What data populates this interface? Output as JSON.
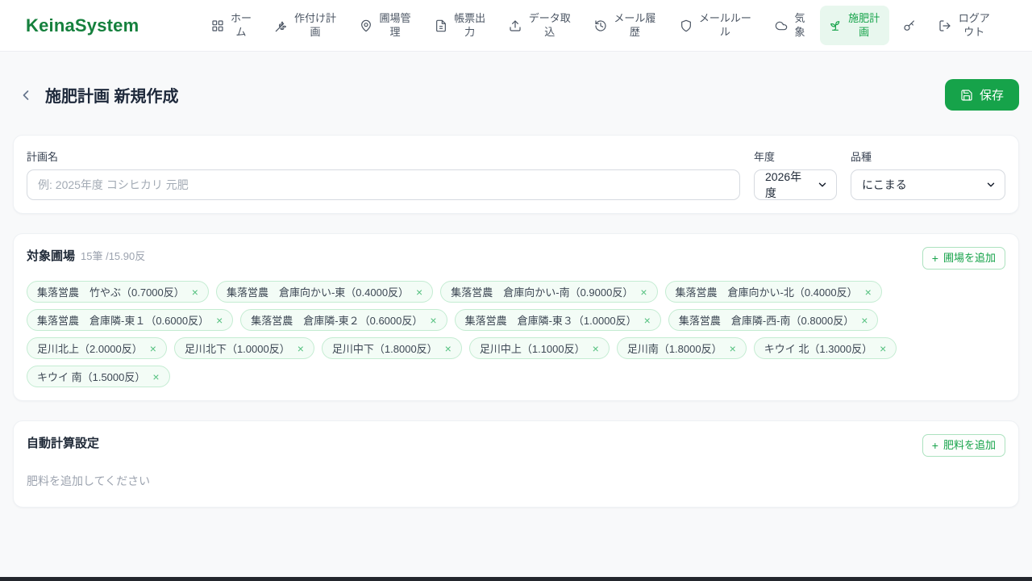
{
  "brand": "KeinaSystem",
  "colors": {
    "accent_green": "#16a34a",
    "brand_green": "#15803d",
    "active_nav_bg": "#e8f7ee",
    "chip_bg": "#f3fcf6",
    "chip_border": "#c4ecd2",
    "page_bg": "#f8f9fa"
  },
  "symbols": {
    "plus": "+",
    "close": "×"
  },
  "nav": {
    "items": [
      {
        "label": "ホーム",
        "icon": "grid-icon",
        "active": false
      },
      {
        "label": "作付け計画",
        "icon": "wheat-icon",
        "active": false
      },
      {
        "label": "圃場管理",
        "icon": "map-pin-icon",
        "active": false
      },
      {
        "label": "帳票出力",
        "icon": "document-icon",
        "active": false
      },
      {
        "label": "データ取込",
        "icon": "upload-icon",
        "active": false
      },
      {
        "label": "メール履歴",
        "icon": "history-icon",
        "active": false
      },
      {
        "label": "メールルール",
        "icon": "shield-icon",
        "active": false
      },
      {
        "label": "気象",
        "icon": "cloud-icon",
        "active": false
      },
      {
        "label": "施肥計画",
        "icon": "sprout-icon",
        "active": true
      },
      {
        "label": "",
        "icon": "key-icon",
        "active": false
      },
      {
        "label": "ログアウト",
        "icon": "logout-icon",
        "active": false
      }
    ]
  },
  "header": {
    "title": "施肥計画 新規作成",
    "save_label": "保存"
  },
  "form": {
    "plan_name_label": "計画名",
    "plan_name_placeholder": "例: 2025年度 コシヒカリ 元肥",
    "year_label": "年度",
    "year_value": "2026年度",
    "variety_label": "品種",
    "variety_value": "にこまる"
  },
  "fields_section": {
    "title": "対象圃場",
    "summary": "15筆 /15.90反",
    "add_button_label": "圃場を追加",
    "chips": [
      "集落営農　竹やぶ（0.7000反）",
      "集落営農　倉庫向かい-東（0.4000反）",
      "集落営農　倉庫向かい-南（0.9000反）",
      "集落営農　倉庫向かい-北（0.4000反）",
      "集落営農　倉庫隣-東１（0.6000反）",
      "集落営農　倉庫隣-東２（0.6000反）",
      "集落営農　倉庫隣-東３（1.0000反）",
      "集落営農　倉庫隣-西-南（0.8000反）",
      "足川北上（2.0000反）",
      "足川北下（1.0000反）",
      "足川中下（1.8000反）",
      "足川中上（1.1000反）",
      "足川南（1.8000反）",
      "キウイ 北（1.3000反）",
      "キウイ 南（1.5000反）"
    ]
  },
  "auto_calc": {
    "title": "自動計算設定",
    "add_button_label": "肥料を追加",
    "empty_message": "肥料を追加してください"
  }
}
